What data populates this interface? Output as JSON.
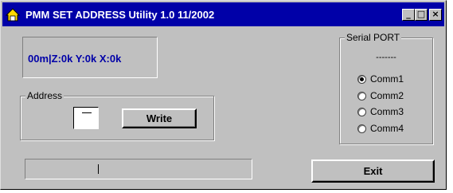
{
  "window": {
    "title": "PMM SET ADDRESS Utility 1.0 11/2002",
    "colors": {
      "titlebar": "#0000a8",
      "face": "#c0c0c0",
      "coord_text": "#0000a8"
    },
    "controls": {
      "minimize": "_",
      "maximize": "□",
      "close": "×"
    }
  },
  "coordinates": {
    "text": "00m|Z:0k Y:0k X:0k"
  },
  "address": {
    "group_label": "Address",
    "value": "",
    "write_label": "Write"
  },
  "serial_port": {
    "group_label": "Serial PORT",
    "status": "-------",
    "options": [
      {
        "label": "Comm1",
        "checked": true
      },
      {
        "label": "Comm2",
        "checked": false
      },
      {
        "label": "Comm3",
        "checked": false
      },
      {
        "label": "Comm4",
        "checked": false
      }
    ]
  },
  "progress": {
    "value": 0
  },
  "exit_label": "Exit"
}
